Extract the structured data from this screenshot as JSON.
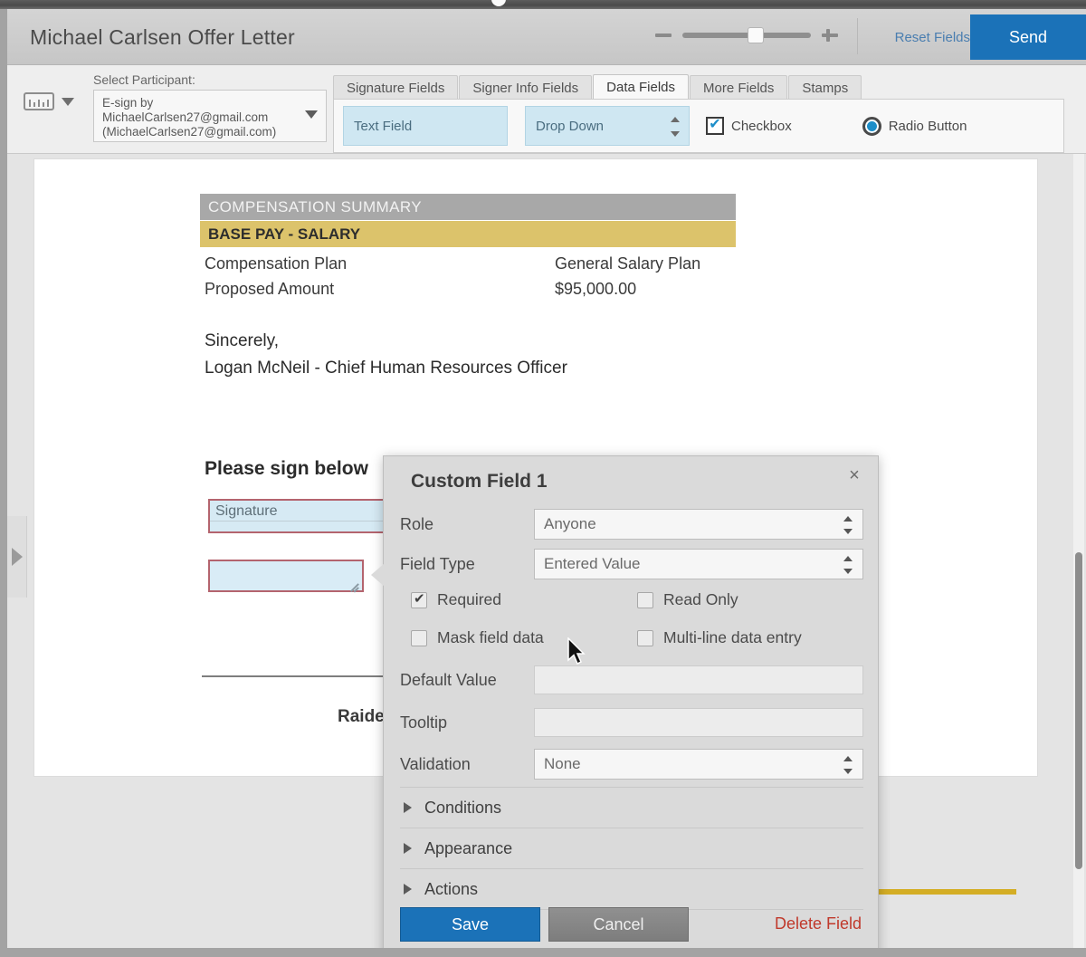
{
  "header": {
    "document_title": "Michael Carlsen Offer Letter",
    "reset_fields_label": "Reset Fields",
    "send_label": "Send",
    "zoom_minus_icon": "minus-icon",
    "zoom_plus_icon": "plus-icon"
  },
  "toolbar": {
    "ruler_icon": "ruler-icon",
    "ruler_caret_icon": "chevron-down-icon",
    "participant": {
      "label": "Select Participant:",
      "value_line1": "E-sign by",
      "value_line2": "MichaelCarlsen27@gmail.com",
      "value_line3": "(MichaelCarlsen27@gmail.com)",
      "caret_icon": "chevron-down-icon"
    },
    "tabs": [
      {
        "label": "Signature Fields",
        "active": false
      },
      {
        "label": "Signer Info Fields",
        "active": false
      },
      {
        "label": "Data Fields",
        "active": true
      },
      {
        "label": "More Fields",
        "active": false
      },
      {
        "label": "Stamps",
        "active": false
      }
    ],
    "fields": {
      "text_field": "Text Field",
      "drop_down": "Drop Down",
      "checkbox": "Checkbox",
      "radio_button": "Radio Button"
    }
  },
  "document": {
    "compensation_summary_heading": "COMPENSATION SUMMARY",
    "base_pay_heading": "BASE PAY - SALARY",
    "rows": [
      {
        "label": "Compensation Plan",
        "value": "General Salary Plan"
      },
      {
        "label": "Proposed Amount",
        "value": "$95,000.00"
      }
    ],
    "sincerely": "Sincerely,",
    "signoff": "Logan McNeil - Chief Human Resources Officer",
    "sign_below": "Please sign below",
    "signature_field_label": "Signature",
    "footer_text": "Raide"
  },
  "dialog": {
    "title": "Custom Field 1",
    "close_icon": "close-icon",
    "role": {
      "label": "Role",
      "value": "Anyone"
    },
    "field_type": {
      "label": "Field Type",
      "value": "Entered Value"
    },
    "checkboxes": [
      {
        "label": "Required",
        "checked": true
      },
      {
        "label": "Read Only",
        "checked": false
      },
      {
        "label": "Mask field data",
        "checked": false
      },
      {
        "label": "Multi-line data entry",
        "checked": false
      }
    ],
    "default_value": {
      "label": "Default Value",
      "value": ""
    },
    "tooltip": {
      "label": "Tooltip",
      "value": ""
    },
    "validation": {
      "label": "Validation",
      "value": "None"
    },
    "sections": [
      {
        "label": "Conditions"
      },
      {
        "label": "Appearance"
      },
      {
        "label": "Actions"
      }
    ],
    "save_label": "Save",
    "cancel_label": "Cancel",
    "delete_label": "Delete Field"
  },
  "colors": {
    "accent_blue": "#1b72b8",
    "delete_red": "#c0392b",
    "gold": "#dcc36b",
    "field_blue": "#cfe7f2"
  }
}
